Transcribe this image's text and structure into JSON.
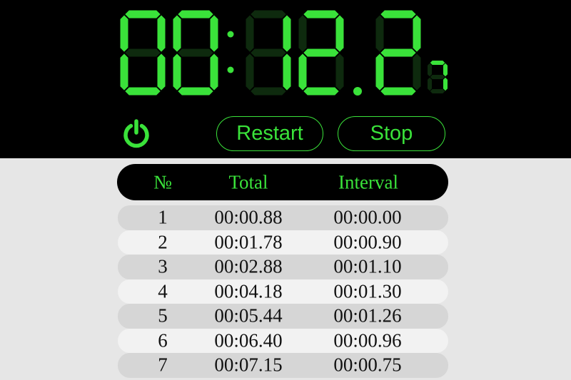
{
  "display": {
    "time": "00:12.2",
    "hundredths": "7"
  },
  "controls": {
    "power_icon": "power-icon",
    "restart_label": "Restart",
    "stop_label": "Stop"
  },
  "laps": {
    "headers": {
      "number": "№",
      "total": "Total",
      "interval": "Interval"
    },
    "rows": [
      {
        "number": "1",
        "total": "00:00.88",
        "interval": "00:00.00"
      },
      {
        "number": "2",
        "total": "00:01.78",
        "interval": "00:00.90"
      },
      {
        "number": "3",
        "total": "00:02.88",
        "interval": "00:01.10"
      },
      {
        "number": "4",
        "total": "00:04.18",
        "interval": "00:01.30"
      },
      {
        "number": "5",
        "total": "00:05.44",
        "interval": "00:01.26"
      },
      {
        "number": "6",
        "total": "00:06.40",
        "interval": "00:00.96"
      },
      {
        "number": "7",
        "total": "00:07.15",
        "interval": "00:00.75"
      }
    ]
  },
  "colors": {
    "accent": "#3ae23a",
    "segment_off": "#0e2a0e",
    "panel": "#000000",
    "row_dark": "#d6d6d6",
    "row_light": "#f2f2f2"
  }
}
